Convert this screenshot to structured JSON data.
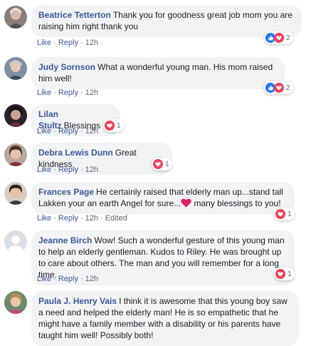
{
  "colors": {
    "link": "#385898",
    "bubble": "#f2f3f5",
    "meta": "#606770",
    "like_blue": "#1877f2",
    "love_red": "#f33e58"
  },
  "comments": [
    {
      "author": "Beatrice Tetterton",
      "text": "Thank you for goodness great job mom you are raising him right thank you",
      "like": "Like",
      "reply": "Reply",
      "time": "12h",
      "reaction_icons": [
        "like-icon",
        "love-icon"
      ],
      "reaction_count": "2"
    },
    {
      "author": "Judy Sornson",
      "text": "What a wonderful young man. His mom raised him well!",
      "like": "Like",
      "reply": "Reply",
      "time": "12h",
      "reaction_icons": [
        "like-icon",
        "love-icon"
      ],
      "reaction_count": "2"
    },
    {
      "author": "Lilan Stultz",
      "text": "Blessings",
      "like": "Like",
      "reply": "Reply",
      "time": "12h",
      "reaction_icons": [
        "love-icon"
      ],
      "reaction_count": "1"
    },
    {
      "author": "Debra Lewis Dunn",
      "text": "Great kindness",
      "like": "Like",
      "reply": "Reply",
      "time": "12h",
      "reaction_icons": [
        "love-icon"
      ],
      "reaction_count": "1"
    },
    {
      "author": "Frances Page",
      "text_before": "He certainly raised that elderly man up...stand tall Lakken your an earth Angel for sure...",
      "text_after": " many blessings to you!",
      "like": "Like",
      "reply": "Reply",
      "time": "12h",
      "edited": "Edited",
      "reaction_icons": [
        "love-icon"
      ],
      "reaction_count": "1"
    },
    {
      "author": "Jeanne Birch",
      "text": "Wow! Such a wonderful gesture of this young man to help an elderly gentleman. Kudos to Riley. He was brought up to care about others. The man and you will remember for a long time.",
      "like": "Like",
      "reply": "Reply",
      "time": "12h",
      "reaction_icons": [
        "love-icon"
      ],
      "reaction_count": "1"
    },
    {
      "author": "Paula J. Henry Vais",
      "text": "I think it is awesome that this young boy saw a need and helped the elderly man! He is so empathetic that he might have a family member with a disability or his parents have taught him well! Possibly both!"
    }
  ]
}
